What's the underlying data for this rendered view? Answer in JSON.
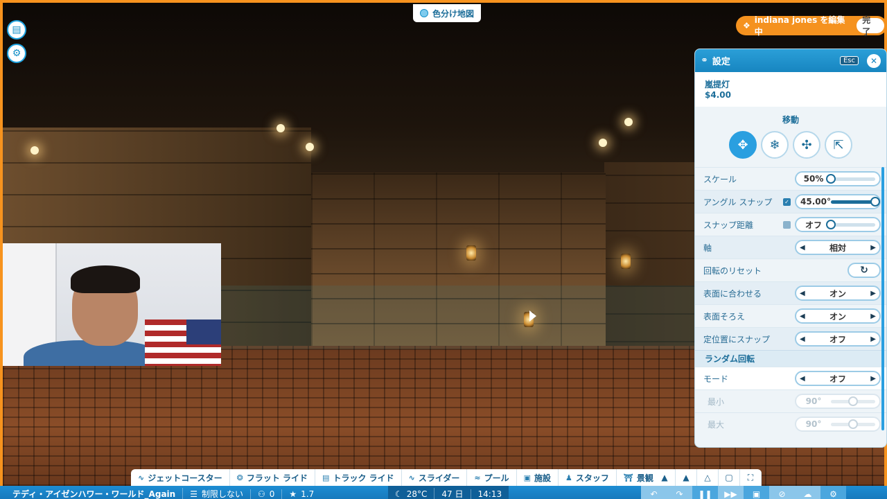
{
  "map_overlay": {
    "label": "色分け地図"
  },
  "edit_banner": {
    "text": "indiana jones を編集中",
    "done_label": "完了"
  },
  "settings": {
    "title": "設定",
    "esc_label": "Esc",
    "item": {
      "name": "嵐提灯",
      "price": "$4.00"
    },
    "move_section": {
      "title": "移動"
    },
    "rows": {
      "scale": {
        "label": "スケール",
        "value": "50%",
        "level_fraction": 0.0
      },
      "angle_snap": {
        "label": "アングル スナップ",
        "value": "45.00°",
        "level_fraction": 1.0,
        "checked": true
      },
      "snap_distance": {
        "label": "スナップ距離",
        "value": "オフ",
        "level_fraction": 0.0,
        "checked": false
      },
      "axis": {
        "label": "軸",
        "value": "相対"
      },
      "reset_rotation": {
        "label": "回転のリセット"
      },
      "align_surface": {
        "label": "表面に合わせる",
        "value": "オン"
      },
      "surface_flush": {
        "label": "表面そろえ",
        "value": "オン"
      },
      "grid_snap": {
        "label": "定位置にスナップ",
        "value": "オフ"
      }
    },
    "random_rotation": {
      "title": "ランダム回転",
      "mode": {
        "label": "モード",
        "value": "オフ"
      },
      "min": {
        "label": "最小",
        "value": "90°",
        "level_fraction": 0.5
      },
      "max": {
        "label": "最大",
        "value": "90°",
        "level_fraction": 0.5
      }
    }
  },
  "toolbar": {
    "tabs": [
      {
        "label": "ジェットコースター"
      },
      {
        "label": "フラット ライド"
      },
      {
        "label": "トラック ライド"
      },
      {
        "label": "スライダー"
      },
      {
        "label": "プール"
      },
      {
        "label": "施設"
      },
      {
        "label": "スタッフ"
      },
      {
        "label": "景観"
      }
    ]
  },
  "statusbar": {
    "park_name": "テディ・アイゼンハワー・ワールド_Again",
    "money": "制限しない",
    "guests": "0",
    "rating": "1.7",
    "temperature": "28°C",
    "day": "47 日",
    "time": "14:13"
  },
  "colors": {
    "accent": "#1b6d99",
    "header_blue": "#1785c0",
    "banner_orange": "#f5921f",
    "border_orange": "#f7931e",
    "statusbar_blue": "#1676b8"
  }
}
